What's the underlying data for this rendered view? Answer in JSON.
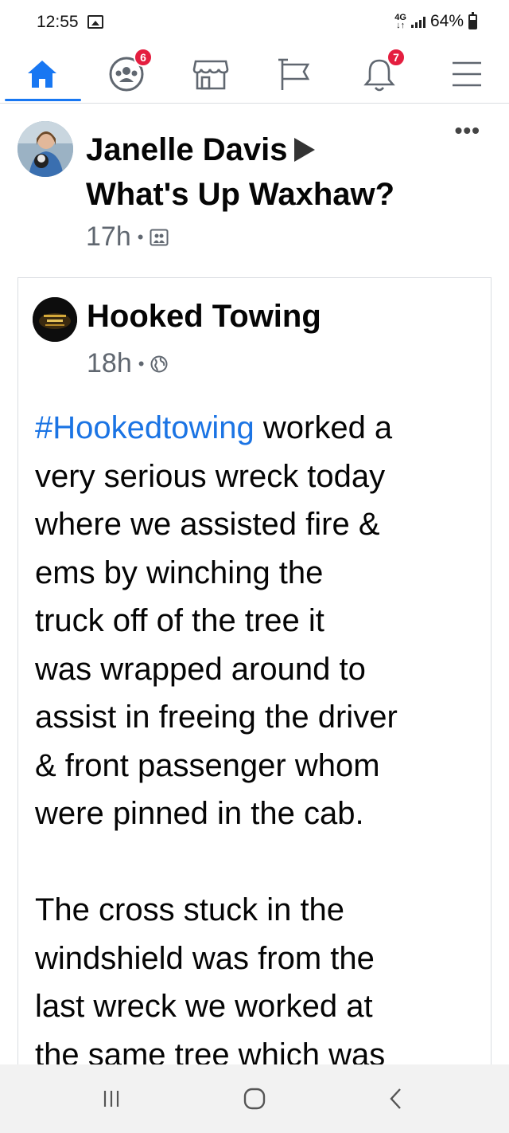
{
  "status_bar": {
    "time": "12:55",
    "network": "4G",
    "battery_percent": "64%",
    "battery_level": 0.64
  },
  "nav": {
    "groups_badge": "6",
    "notifications_badge": "7",
    "active_tab": "home",
    "accent_color": "#1877f2"
  },
  "post": {
    "author": "Janelle Davis",
    "group": "What's Up Waxhaw?",
    "time": "17h",
    "separator": "•"
  },
  "shared": {
    "page_name": "Hooked Towing",
    "time": "18h",
    "separator": "•",
    "hashtag": "#Hookedtowing",
    "body_lines_1": [
      " worked a",
      "very serious wreck today",
      "where we assisted fire &",
      "ems by winching the",
      "truck off of the tree it",
      "was wrapped around to",
      "assist in freeing the driver",
      "& front passenger whom",
      "were pinned in the cab."
    ],
    "body_lines_2": [
      "The cross stuck in the",
      "windshield was from the",
      "last wreck we worked at",
      "the same tree which was"
    ]
  }
}
